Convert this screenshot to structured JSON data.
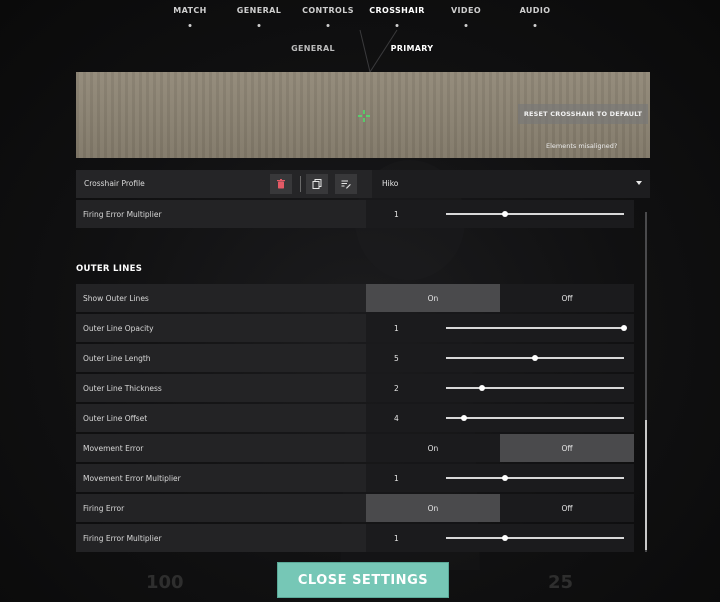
{
  "top_nav": {
    "items": [
      {
        "label": "MATCH"
      },
      {
        "label": "GENERAL"
      },
      {
        "label": "CONTROLS"
      },
      {
        "label": "CROSSHAIR"
      },
      {
        "label": "VIDEO"
      },
      {
        "label": "AUDIO"
      }
    ],
    "active": "CROSSHAIR"
  },
  "sub_nav": {
    "items": [
      {
        "label": "GENERAL"
      },
      {
        "label": "PRIMARY"
      }
    ],
    "active": "PRIMARY"
  },
  "preview": {
    "reset_label": "RESET CROSSHAIR TO DEFAULT",
    "misaligned_label": "Elements misaligned?",
    "crosshair_color": "#3cff6a"
  },
  "profile": {
    "label": "Crosshair Profile",
    "value": "Hiko",
    "icons": [
      "trash-icon",
      "copy-icon",
      "rename-icon"
    ]
  },
  "rows": [
    {
      "label": "Firing Error Multiplier",
      "value": "1",
      "fraction": 0.33
    },
    {
      "section": "OUTER LINES"
    },
    {
      "label": "Show Outer Lines",
      "on": "On",
      "off": "Off",
      "selected": "on"
    },
    {
      "label": "Outer Line Opacity",
      "value": "1",
      "fraction": 1.0
    },
    {
      "label": "Outer Line Length",
      "value": "5",
      "fraction": 0.5
    },
    {
      "label": "Outer Line Thickness",
      "value": "2",
      "fraction": 0.2
    },
    {
      "label": "Outer Line Offset",
      "value": "4",
      "fraction": 0.1
    },
    {
      "label": "Movement Error",
      "on": "On",
      "off": "Off",
      "selected": "off"
    },
    {
      "label": "Movement Error Multiplier",
      "value": "1",
      "fraction": 0.33
    },
    {
      "label": "Firing Error",
      "on": "On",
      "off": "Off",
      "selected": "on"
    },
    {
      "label": "Firing Error Multiplier",
      "value": "1",
      "fraction": 0.33
    }
  ],
  "close_label": "CLOSE SETTINGS",
  "hud": {
    "left": "100",
    "right": "25"
  },
  "colors": {
    "accent": "#76c7b6",
    "selected_toggle": "#4a4a4c"
  }
}
